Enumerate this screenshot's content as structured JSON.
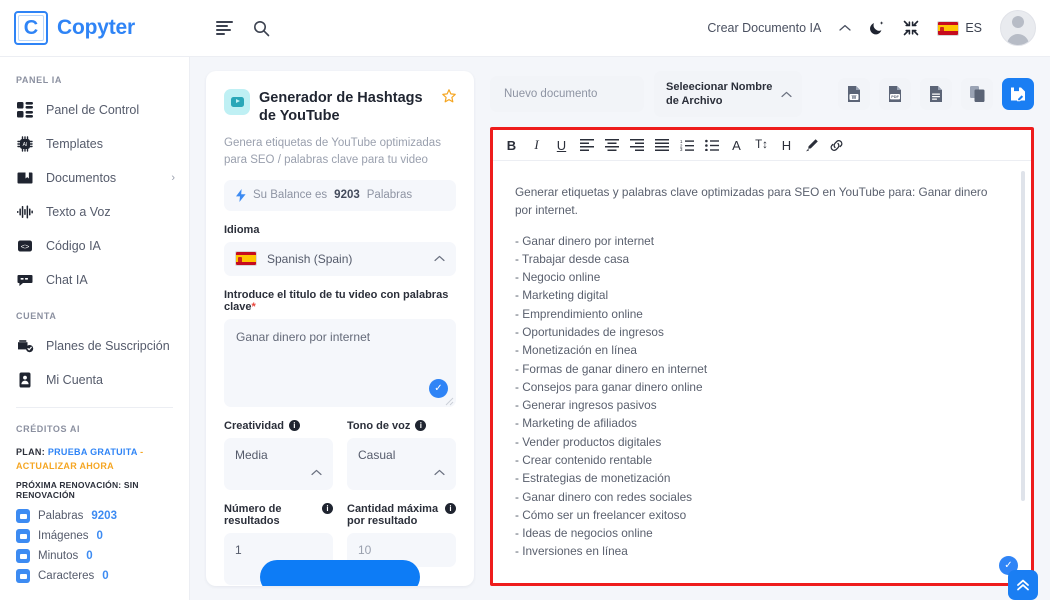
{
  "header": {
    "brand_letter": "C",
    "brand_name": "Copyter",
    "menu_icon": "list-menu-icon",
    "search_icon": "search-icon",
    "create_document": "Crear Documento IA",
    "theme_icon": "moon-icon",
    "fullscreen_icon": "compress-icon",
    "lang_code": "ES",
    "avatar": "user-avatar"
  },
  "sidebar": {
    "section_panel": "PANEL IA",
    "items": [
      {
        "label": "Panel de Control",
        "icon": "dashboard-icon",
        "caret": ""
      },
      {
        "label": "Templates",
        "icon": "chip-ai-icon",
        "caret": ""
      },
      {
        "label": "Documentos",
        "icon": "folder-icon",
        "caret": "›"
      },
      {
        "label": "Texto a Voz",
        "icon": "waveform-icon",
        "caret": ""
      },
      {
        "label": "Código IA",
        "icon": "code-icon",
        "caret": ""
      },
      {
        "label": "Chat IA",
        "icon": "chat-icon",
        "caret": ""
      }
    ],
    "section_account": "CUENTA",
    "account_items": [
      {
        "label": "Planes de Suscripción",
        "icon": "subscription-icon"
      },
      {
        "label": "Mi Cuenta",
        "icon": "id-card-icon"
      }
    ],
    "section_credits": "CRÉDITOS AI",
    "plan_prefix": "PLAN:",
    "plan_name": "PRUEBA GRATUITA",
    "plan_upgrade": "- ACTUALIZAR AHORA",
    "renewal": "PRÓXIMA RENOVACIÓN: SIN RENOVACIÓN",
    "credits": [
      {
        "label": "Palabras",
        "value": "9203",
        "icon": "words-icon"
      },
      {
        "label": "Imágenes",
        "value": "0",
        "icon": "images-icon"
      },
      {
        "label": "Minutos",
        "value": "0",
        "icon": "minutes-icon"
      },
      {
        "label": "Caracteres",
        "value": "0",
        "icon": "characters-icon"
      }
    ]
  },
  "form": {
    "template_icon": "youtube-video-icon",
    "title": "Generador de Hashtags de YouTube",
    "favorite_icon": "star-outline-icon",
    "description": "Genera etiquetas de YouTube optimizadas para SEO / palabras clave para tu video",
    "balance_icon": "bolt-icon",
    "balance_prefix": "Su Balance es",
    "balance_value": "9203",
    "balance_suffix": "Palabras",
    "language_label": "Idioma",
    "language_value": "Spanish (Spain)",
    "language_flag": "spain-flag-icon",
    "title_field_label": "Introduce el titulo de tu video con palabras clave",
    "title_field_required": "*",
    "title_field_value": "Ganar dinero por internet",
    "creativity_label": "Creatividad",
    "creativity_value": "Media",
    "tone_label": "Tono de voz",
    "tone_value": "Casual",
    "results_label": "Número de resultados",
    "results_value": "1",
    "max_qty_label": "Cantidad máxima por resultado",
    "max_qty_value": "10",
    "generate_button": ""
  },
  "editor": {
    "doc_name_placeholder": "Nuevo documento",
    "file_select_label": "Seleecionar Nombre de Archivo",
    "export_buttons": [
      {
        "name": "export-word-button",
        "label": "W"
      },
      {
        "name": "export-pdf-button",
        "label": "PDF"
      },
      {
        "name": "export-text-button",
        "label": ""
      },
      {
        "name": "copy-button",
        "label": ""
      },
      {
        "name": "save-document-button",
        "label": ""
      }
    ],
    "toolbar": [
      {
        "name": "bold-button",
        "glyph": "B",
        "cls": "bold"
      },
      {
        "name": "italic-button",
        "glyph": "I",
        "cls": "italic"
      },
      {
        "name": "underline-button",
        "glyph": "U",
        "cls": "underline"
      },
      {
        "name": "align-left-button",
        "glyph": "",
        "cls": ""
      },
      {
        "name": "align-center-button",
        "glyph": "",
        "cls": ""
      },
      {
        "name": "align-right-button",
        "glyph": "",
        "cls": ""
      },
      {
        "name": "align-justify-button",
        "glyph": "",
        "cls": ""
      },
      {
        "name": "ordered-list-button",
        "glyph": "",
        "cls": ""
      },
      {
        "name": "unordered-list-button",
        "glyph": "",
        "cls": ""
      },
      {
        "name": "font-family-button",
        "glyph": "A",
        "cls": ""
      },
      {
        "name": "font-size-button",
        "glyph": "T↕",
        "cls": ""
      },
      {
        "name": "heading-button",
        "glyph": "H",
        "cls": ""
      },
      {
        "name": "text-color-button",
        "glyph": "",
        "cls": ""
      },
      {
        "name": "insert-link-button",
        "glyph": "",
        "cls": ""
      }
    ],
    "content_intro": "Generar etiquetas y palabras clave optimizadas para SEO en YouTube para: Ganar dinero por internet.",
    "content_items": [
      "- Ganar dinero por internet",
      "- Trabajar desde casa",
      "- Negocio online",
      "- Marketing digital",
      "- Emprendimiento online",
      "- Oportunidades de ingresos",
      "- Monetización en línea",
      "- Formas de ganar dinero en internet",
      "- Consejos para ganar dinero online",
      "- Generar ingresos pasivos",
      "- Marketing de afiliados",
      "- Vender productos digitales",
      "- Crear contenido rentable",
      "- Estrategias de monetización",
      "- Ganar dinero con redes sociales",
      "- Cómo ser un freelancer exitoso",
      "- Ideas de negocios online",
      "- Inversiones en línea"
    ],
    "scroll_top_icon": "chevron-up-icon",
    "highlight_color": "#ee1c1c"
  },
  "colors": {
    "brand": "#2f84f6",
    "accent_blue": "#1a7ef3",
    "orange": "#f5a623",
    "highlight": "#ee1c1c",
    "page_bg": "#f4f6fa"
  }
}
